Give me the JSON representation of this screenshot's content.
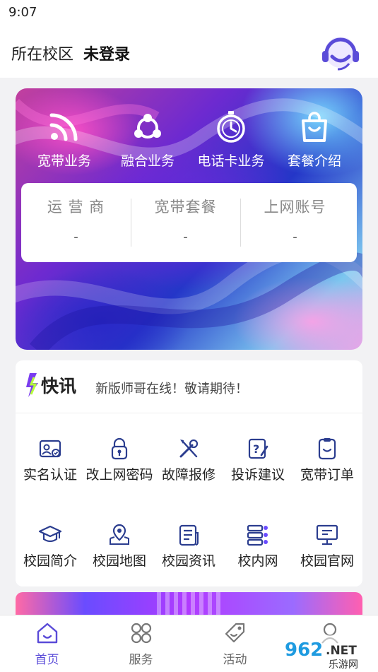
{
  "status": {
    "time": "9:07"
  },
  "header": {
    "campus_label": "所在校区",
    "login_state": "未登录",
    "support_icon": "customer-service-icon"
  },
  "banner": {
    "business": [
      {
        "label": "宽带业务",
        "icon": "wifi-icon"
      },
      {
        "label": "融合业务",
        "icon": "share-network-icon"
      },
      {
        "label": "电话卡业务",
        "icon": "stopwatch-icon"
      },
      {
        "label": "套餐介绍",
        "icon": "shopping-bag-icon"
      }
    ],
    "account": [
      {
        "title": "运 营 商",
        "value": "-"
      },
      {
        "title": "宽带套餐",
        "value": "-"
      },
      {
        "title": "上网账号",
        "value": "-"
      }
    ]
  },
  "news": {
    "logo_text": "快讯",
    "text": "新版师哥在线！敬请期待！"
  },
  "services": [
    {
      "label": "实名认证",
      "icon": "id-card-icon"
    },
    {
      "label": "改上网密码",
      "icon": "lock-icon"
    },
    {
      "label": "故障报修",
      "icon": "repair-tools-icon"
    },
    {
      "label": "投诉建议",
      "icon": "feedback-icon"
    },
    {
      "label": "宽带订单",
      "icon": "order-clipboard-icon"
    },
    {
      "label": "校园简介",
      "icon": "graduation-cap-icon"
    },
    {
      "label": "校园地图",
      "icon": "map-pin-icon"
    },
    {
      "label": "校园资讯",
      "icon": "news-document-icon"
    },
    {
      "label": "校内网",
      "icon": "server-network-icon"
    },
    {
      "label": "校园官网",
      "icon": "monitor-icon"
    }
  ],
  "tabs": [
    {
      "label": "首页",
      "icon": "home-icon",
      "active": true
    },
    {
      "label": "服务",
      "icon": "clover-grid-icon",
      "active": false
    },
    {
      "label": "活动",
      "icon": "tag-icon",
      "active": false
    },
    {
      "label": "",
      "icon": "profile-icon",
      "active": false
    }
  ],
  "watermark": {
    "text": "962.NET",
    "subtext": "乐游网"
  },
  "colors": {
    "accent": "#5a4bd8",
    "icon_blue": "#2b3d8f",
    "background": "#f2f2f4"
  }
}
